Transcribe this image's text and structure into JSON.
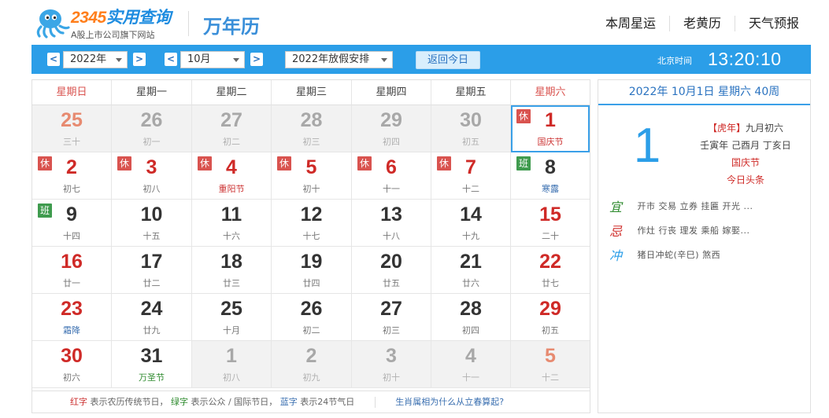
{
  "header": {
    "brand_logo_text": "2345实用查询",
    "brand_subtitle": "A股上市公司旗下网站",
    "site_title": "万年历",
    "nav": [
      "本周星运",
      "老黄历",
      "天气预报"
    ]
  },
  "toolbar": {
    "year_select": "2022年",
    "month_select": "10月",
    "holiday_select": "2022年放假安排",
    "today_button": "返回今日",
    "timezone_label": "北京时间",
    "clock": "13:20:10",
    "prev_arrow": "<",
    "next_arrow": ">"
  },
  "calendar": {
    "weekdays": [
      "星期日",
      "星期一",
      "星期二",
      "星期三",
      "星期四",
      "星期五",
      "星期六"
    ],
    "rows": [
      [
        {
          "day": "25",
          "lunar": "三十",
          "other": true,
          "red": true
        },
        {
          "day": "26",
          "lunar": "初一",
          "other": true
        },
        {
          "day": "27",
          "lunar": "初二",
          "other": true
        },
        {
          "day": "28",
          "lunar": "初三",
          "other": true
        },
        {
          "day": "29",
          "lunar": "初四",
          "other": true
        },
        {
          "day": "30",
          "lunar": "初五",
          "other": true
        },
        {
          "day": "1",
          "lunar": "国庆节",
          "lunar_style": "fest",
          "red": true,
          "badge": "休",
          "today": true
        }
      ],
      [
        {
          "day": "2",
          "lunar": "初七",
          "red": true,
          "badge": "休"
        },
        {
          "day": "3",
          "lunar": "初八",
          "red": true,
          "badge": "休"
        },
        {
          "day": "4",
          "lunar": "重阳节",
          "lunar_style": "fest",
          "red": true,
          "badge": "休"
        },
        {
          "day": "5",
          "lunar": "初十",
          "red": true,
          "badge": "休"
        },
        {
          "day": "6",
          "lunar": "十一",
          "red": true,
          "badge": "休"
        },
        {
          "day": "7",
          "lunar": "十二",
          "red": true,
          "badge": "休"
        },
        {
          "day": "8",
          "lunar": "寒露",
          "lunar_style": "term",
          "badge": "班"
        }
      ],
      [
        {
          "day": "9",
          "lunar": "十四",
          "badge": "班"
        },
        {
          "day": "10",
          "lunar": "十五"
        },
        {
          "day": "11",
          "lunar": "十六"
        },
        {
          "day": "12",
          "lunar": "十七"
        },
        {
          "day": "13",
          "lunar": "十八"
        },
        {
          "day": "14",
          "lunar": "十九"
        },
        {
          "day": "15",
          "lunar": "二十",
          "red": true
        }
      ],
      [
        {
          "day": "16",
          "lunar": "廿一",
          "red": true
        },
        {
          "day": "17",
          "lunar": "廿二"
        },
        {
          "day": "18",
          "lunar": "廿三"
        },
        {
          "day": "19",
          "lunar": "廿四"
        },
        {
          "day": "20",
          "lunar": "廿五"
        },
        {
          "day": "21",
          "lunar": "廿六"
        },
        {
          "day": "22",
          "lunar": "廿七",
          "red": true
        }
      ],
      [
        {
          "day": "23",
          "lunar": "霜降",
          "lunar_style": "term",
          "red": true
        },
        {
          "day": "24",
          "lunar": "廿九"
        },
        {
          "day": "25",
          "lunar": "十月"
        },
        {
          "day": "26",
          "lunar": "初二"
        },
        {
          "day": "27",
          "lunar": "初三"
        },
        {
          "day": "28",
          "lunar": "初四"
        },
        {
          "day": "29",
          "lunar": "初五",
          "red": true
        }
      ],
      [
        {
          "day": "30",
          "lunar": "初六",
          "red": true
        },
        {
          "day": "31",
          "lunar": "万圣节",
          "lunar_style": "intl"
        },
        {
          "day": "1",
          "lunar": "初八",
          "other": true
        },
        {
          "day": "2",
          "lunar": "初九",
          "other": true
        },
        {
          "day": "3",
          "lunar": "初十",
          "other": true
        },
        {
          "day": "4",
          "lunar": "十一",
          "other": true
        },
        {
          "day": "5",
          "lunar": "十二",
          "other": true,
          "red": true
        }
      ]
    ],
    "legend": {
      "red_word": "红字",
      "red_desc": "表示农历传统节日，",
      "green_word": "绿字",
      "green_desc": "表示公众 / 国际节日，",
      "blue_word": "蓝字",
      "blue_desc": "表示24节气日",
      "tip_link": "生肖属相为什么从立春算起?"
    }
  },
  "side_panel": {
    "date_header": "2022年 10月1日 星期六 40周",
    "big_day": "1",
    "zodiac_bracket": "【虎年】",
    "lunar_date": "九月初六",
    "ganzhi": "壬寅年  己酉月  丁亥日",
    "festival": "国庆节",
    "news_link": "今日头条",
    "yi_label": "宜",
    "yi_items": "开市  交易  立券  挂匾  开光  ...",
    "ji_label": "忌",
    "ji_items": "作灶  行丧  理发  乘船  嫁娶...",
    "chong_label": "冲",
    "chong_items": "猪日冲蛇(辛巳)  煞西"
  },
  "colors": {
    "accent_blue": "#2b9ee8",
    "holiday_red": "#d9534f",
    "workday_green": "#3f9b4e"
  }
}
